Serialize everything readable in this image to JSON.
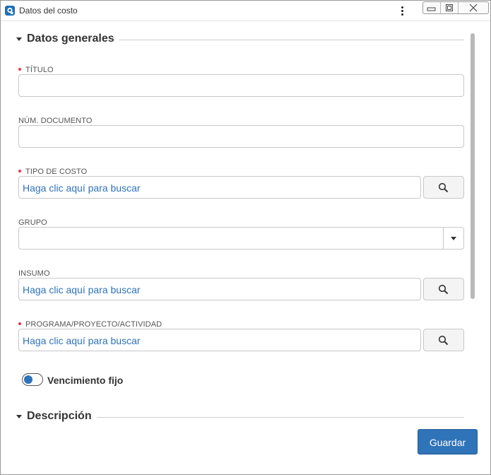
{
  "window": {
    "title": "Datos del costo"
  },
  "sections": {
    "general": {
      "title": "Datos generales"
    },
    "description": {
      "title": "Descripción"
    }
  },
  "fields": {
    "titulo": {
      "label": "TÍTULO",
      "required": true,
      "value": ""
    },
    "num_documento": {
      "label": "NÚM. DOCUMENTO",
      "required": false,
      "value": ""
    },
    "tipo_costo": {
      "label": "TIPO DE COSTO",
      "required": true,
      "value": "Haga clic aquí para buscar"
    },
    "grupo": {
      "label": "GRUPO",
      "required": false,
      "value": ""
    },
    "insumo": {
      "label": "INSUMO",
      "required": false,
      "value": "Haga clic aquí para buscar"
    },
    "programa": {
      "label": "PROGRAMA/PROYECTO/ACTIVIDAD",
      "required": true,
      "value": "Haga clic aquí para buscar"
    }
  },
  "toggle": {
    "label": "Vencimiento fijo",
    "on": false
  },
  "buttons": {
    "save": "Guardar"
  },
  "colors": {
    "accent": "#2f73b8",
    "required": "#e0394a"
  },
  "icons": {
    "app": "app-logo-icon",
    "menu": "kebab-menu-icon",
    "search": "magnifier-icon"
  }
}
